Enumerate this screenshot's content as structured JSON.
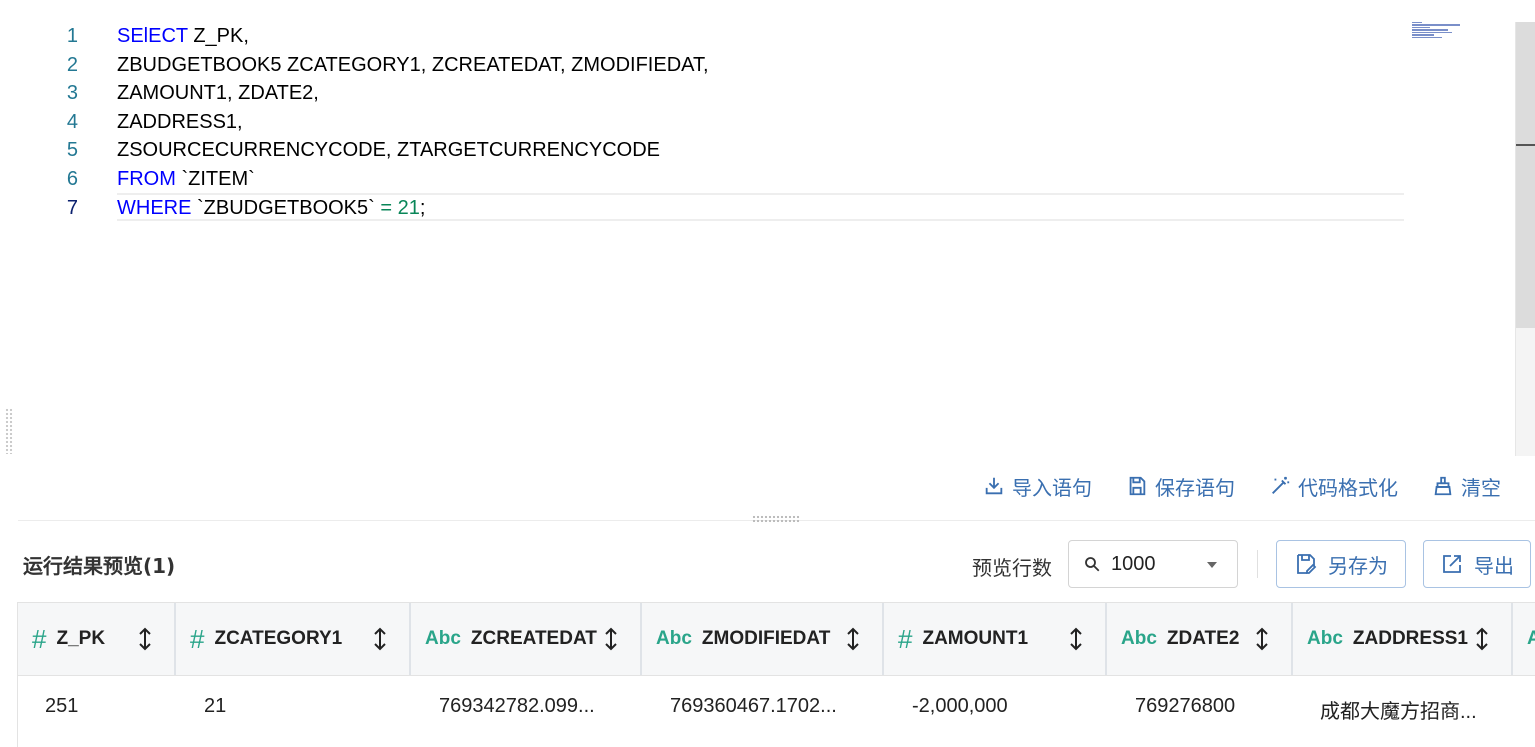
{
  "editor": {
    "lines": [
      {
        "n": "1",
        "parts": [
          {
            "t": "SElECT",
            "c": "kw"
          },
          {
            "t": " Z_PK,",
            "c": ""
          }
        ]
      },
      {
        "n": "2",
        "parts": [
          {
            "t": "ZBUDGETBOOK5 ZCATEGORY1, ZCREATEDAT, ZMODIFIEDAT,",
            "c": ""
          }
        ]
      },
      {
        "n": "3",
        "parts": [
          {
            "t": "ZAMOUNT1, ZDATE2,",
            "c": ""
          }
        ]
      },
      {
        "n": "4",
        "parts": [
          {
            "t": "ZADDRESS1,",
            "c": ""
          }
        ]
      },
      {
        "n": "5",
        "parts": [
          {
            "t": "ZSOURCECURRENCYCODE, ZTARGETCURRENCYCODE",
            "c": ""
          }
        ]
      },
      {
        "n": "6",
        "parts": [
          {
            "t": "FROM",
            "c": "kw"
          },
          {
            "t": " `ZITEM`",
            "c": ""
          }
        ]
      },
      {
        "n": "7",
        "parts": [
          {
            "t": "WHERE",
            "c": "kw"
          },
          {
            "t": " `ZBUDGETBOOK5` ",
            "c": ""
          },
          {
            "t": "= 21",
            "c": "num"
          },
          {
            "t": ";",
            "c": ""
          }
        ]
      }
    ]
  },
  "toolbar": {
    "import_label": "导入语句",
    "save_label": "保存语句",
    "format_label": "代码格式化",
    "clear_label": "清空"
  },
  "results": {
    "title": "运行结果预览(1)",
    "preview_rows_label": "预览行数",
    "preview_rows_value": "1000",
    "save_as_label": "另存为",
    "export_label": "导出"
  },
  "table": {
    "columns": [
      {
        "type": "#",
        "name": "Z_PK"
      },
      {
        "type": "#",
        "name": "ZCATEGORY1"
      },
      {
        "type": "Abc",
        "name": "ZCREATEDAT"
      },
      {
        "type": "Abc",
        "name": "ZMODIFIEDAT"
      },
      {
        "type": "#",
        "name": "ZAMOUNT1"
      },
      {
        "type": "Abc",
        "name": "ZDATE2"
      },
      {
        "type": "Abc",
        "name": "ZADDRESS1"
      },
      {
        "type": "A",
        "name": ""
      }
    ],
    "rows": [
      [
        "251",
        "21",
        "769342782.099...",
        "769360467.1702...",
        "-2,000,000",
        "769276800",
        "成都大魔方招商..."
      ]
    ]
  },
  "colors": {
    "keyword": "#0000ff",
    "number": "#098658",
    "line_number": "#237893",
    "accent": "#3a6fb0",
    "type_icon": "#2aa58a"
  }
}
